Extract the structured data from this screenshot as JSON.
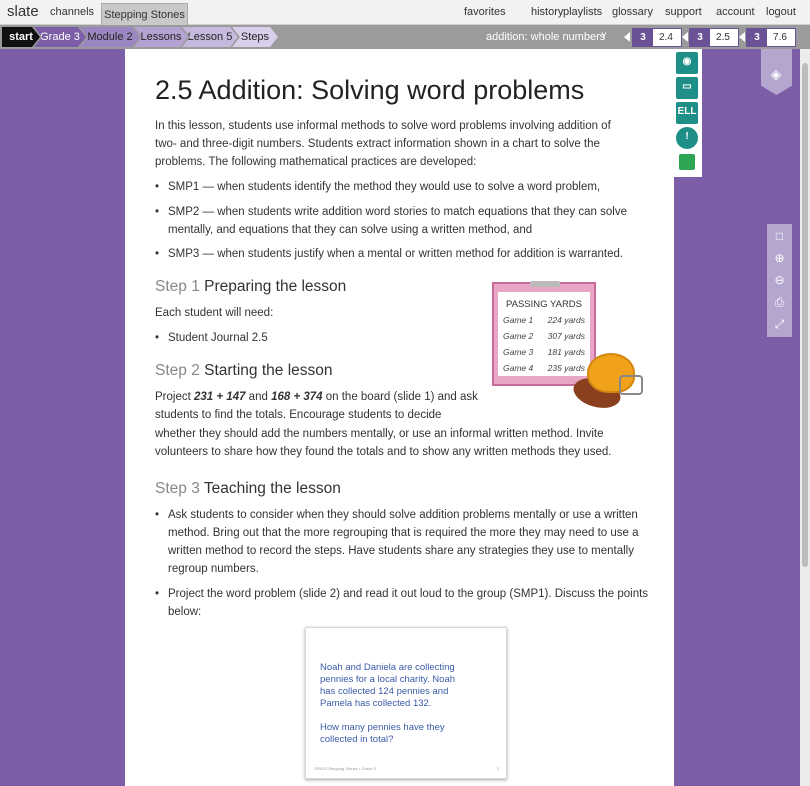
{
  "nav": {
    "brand": "slate",
    "channels": "channels",
    "active_tab": "Stepping Stones",
    "right_links": [
      "favorites",
      "history",
      "playlists",
      "glossary",
      "support",
      "account",
      "logout"
    ]
  },
  "breadcrumb": [
    "start",
    "Grade 3",
    "Module 2",
    "Lessons",
    "Lesson 5",
    "Steps"
  ],
  "topic": "addition: whole numbers",
  "lesson_boxes": [
    {
      "grade": "3",
      "lesson": "2.4"
    },
    {
      "grade": "3",
      "lesson": "2.5"
    },
    {
      "grade": "3",
      "lesson": "7.6"
    }
  ],
  "lesson": {
    "title": "2.5 Addition: Solving word problems",
    "intro_lines": [
      "In this lesson, students use informal methods to solve word problems involving addition of",
      "two- and three-digit numbers. Students extract information shown in a chart to solve the",
      "problems. The following mathematical practices are developed:"
    ],
    "smp1": "SMP1 — when students identify the method they would use to solve a word problem,",
    "smp2_lines": [
      "SMP2 — when students write addition word stories to match equations that they can solve",
      "mentally, and equations that they can solve using a written method, and"
    ],
    "smp3": "SMP3 — when students justify when a mental or written method for addition is warranted.",
    "step1": {
      "num": "Step 1",
      "title": "Preparing the lesson"
    },
    "step1_need": "Each student will need:",
    "step1_item": "Student Journal 2.5",
    "step2": {
      "num": "Step 2",
      "title": "Starting the lesson"
    },
    "step2_p1": {
      "a": "Project ",
      "e1": "231 + 147",
      "b": " and ",
      "e2": "168 + 374",
      "c": " on the board (slide 1) and ask"
    },
    "step2_lines": [
      "students to find the totals. Encourage students to decide",
      "whether they should add the numbers mentally, or use an informal written method. Invite",
      "volunteers to share how they found the totals and to show any written methods they used."
    ],
    "step3": {
      "num": "Step 3",
      "title": "Teaching the lesson"
    },
    "step3_b1_lines": [
      "Ask students to consider when they should solve addition problems mentally or use a written",
      "method. Bring out that the more regrouping that is required the more they may need to use a",
      "written method to record the steps. Have students share any strategies they use to mentally",
      "regroup numbers."
    ],
    "step3_b2_lines": [
      "Project the word problem (slide 2) and read it out loud to the group (SMP1). Discuss the points",
      "below:"
    ]
  },
  "clipboard": {
    "title": "PASSING YARDS",
    "rows": [
      {
        "game": "Game 1",
        "yards": "224 yards"
      },
      {
        "game": "Game 2",
        "yards": "307 yards"
      },
      {
        "game": "Game 3",
        "yards": "181 yards"
      },
      {
        "game": "Game 4",
        "yards": "235 yards"
      }
    ]
  },
  "slide": {
    "lines1": [
      "Noah and Daniela are collecting",
      "pennies for a local charity. Noah",
      "has collected 124 pennies and",
      "Pamela has collected 132."
    ],
    "lines2": [
      "How many pennies have they",
      "collected in total?"
    ],
    "footer": "ORIGO Stepping Stones • Grade 3",
    "page": "2"
  },
  "page_tools": {
    "ell_label": "ELL",
    "alert_label": "!"
  },
  "colors": {
    "purple": "#7b5ea7",
    "teal": "#1e8f86",
    "green": "#2ea653",
    "lilac": "#b4a6ce"
  }
}
